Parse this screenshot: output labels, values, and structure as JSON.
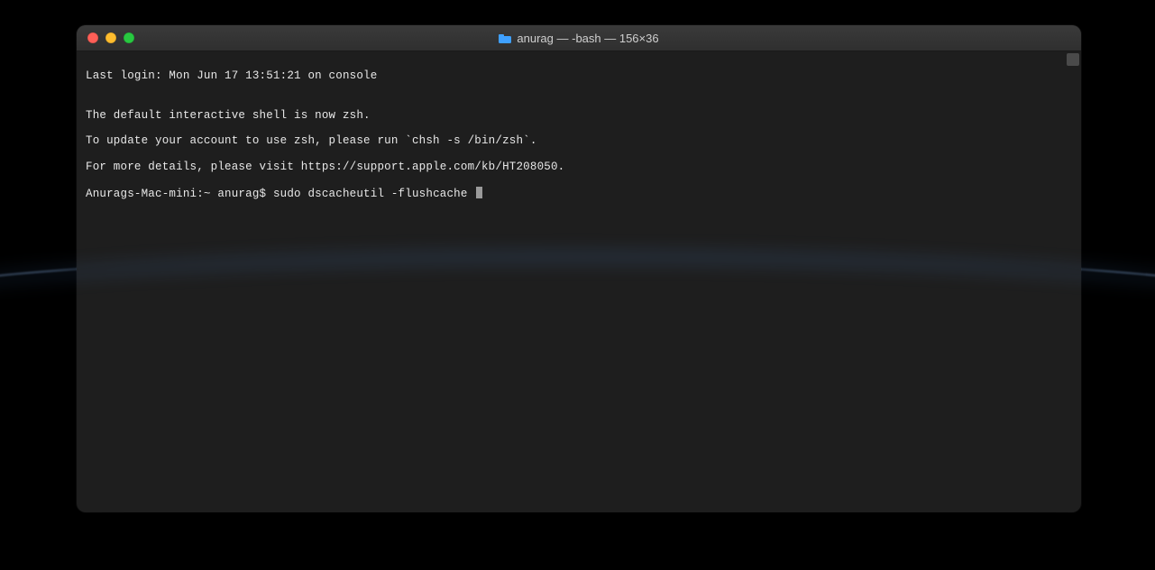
{
  "window": {
    "title": "anurag — -bash — 156×36"
  },
  "terminal": {
    "lines": {
      "last_login": "Last login: Mon Jun 17 13:51:21 on console",
      "blank": "",
      "zsh_notice1": "The default interactive shell is now zsh.",
      "zsh_notice2": "To update your account to use zsh, please run `chsh -s /bin/zsh`.",
      "zsh_notice3": "For more details, please visit https://support.apple.com/kb/HT208050."
    },
    "prompt": "Anurags-Mac-mini:~ anurag$ ",
    "command": "sudo dscacheutil -flushcache "
  }
}
